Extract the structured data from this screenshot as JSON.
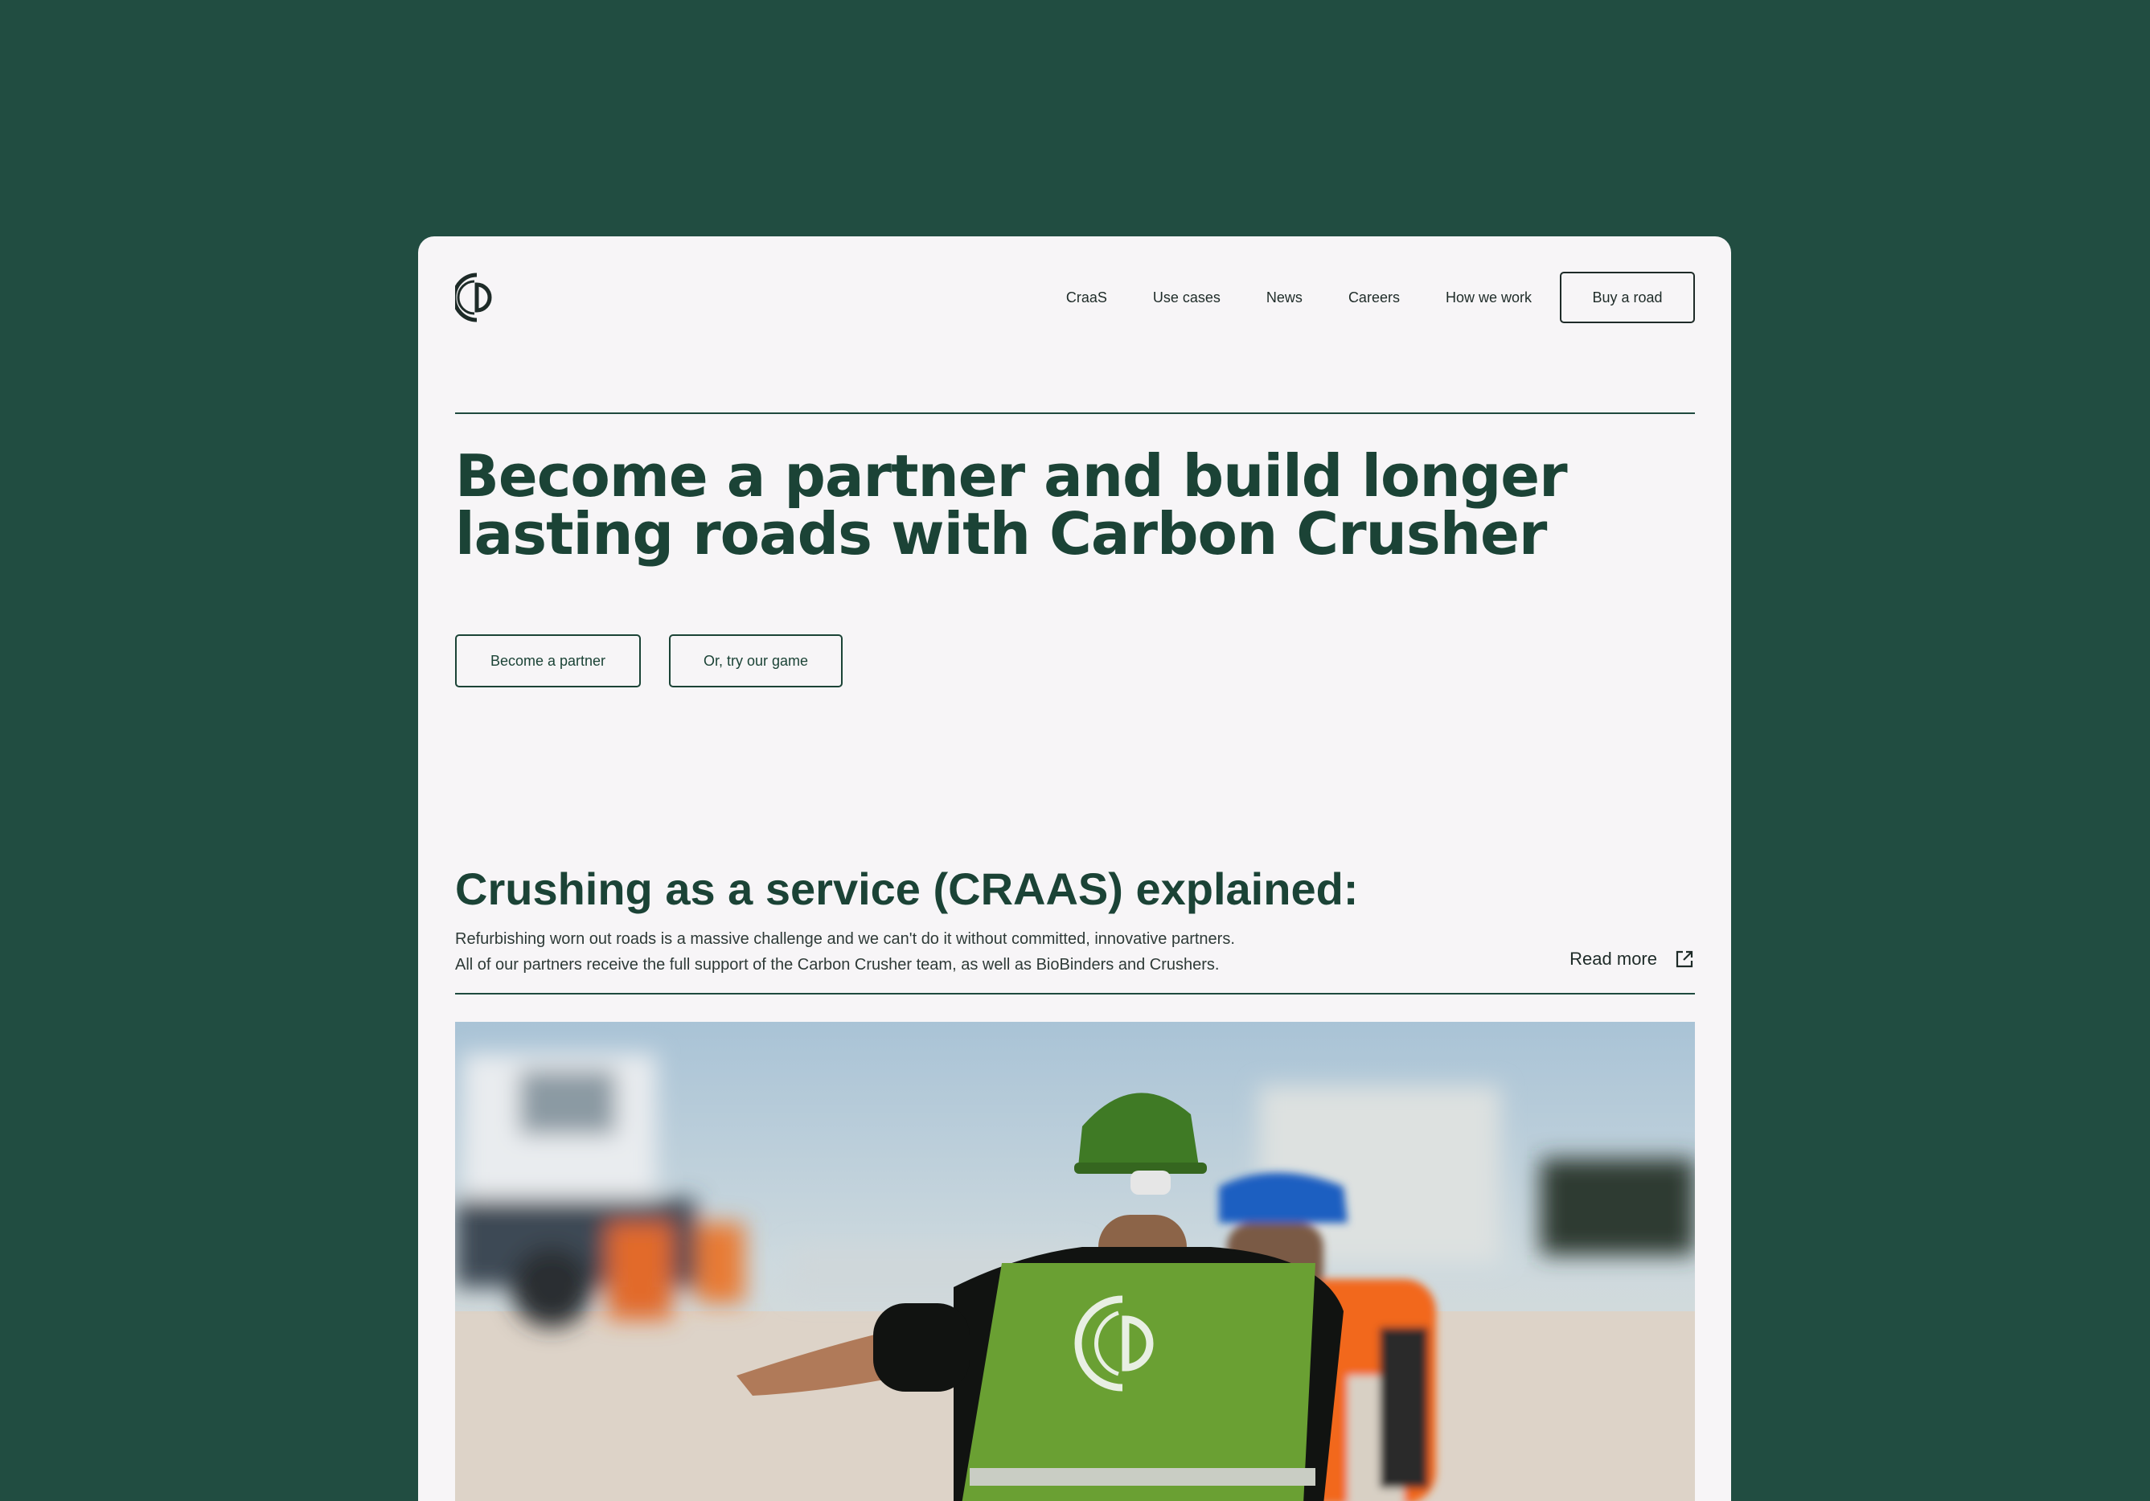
{
  "nav": {
    "items": [
      "CraaS",
      "Use cases",
      "News",
      "Careers",
      "How we work"
    ],
    "cta_label": "Buy a road"
  },
  "hero": {
    "title_line1": "Become a partner and build longer",
    "title_line2": "lasting roads with Carbon Crusher",
    "primary_btn": "Become a partner",
    "secondary_btn": "Or, try our game"
  },
  "craas": {
    "title": "Crushing as a service (CRAAS) explained:",
    "line1": "Refurbishing worn out roads is a massive challenge and we can't do it without committed, innovative partners.",
    "line2": "All of our partners receive the full support of the Carbon Crusher team, as well as BioBinders and Crushers.",
    "read_more": "Read more"
  },
  "icons": {
    "logo": "carbon-crusher-logo",
    "read_more": "external-link-icon"
  },
  "colors": {
    "page_bg": "#214d41",
    "card_bg": "#f7f5f7",
    "heading": "#1b4336",
    "text": "#1e2b28"
  }
}
